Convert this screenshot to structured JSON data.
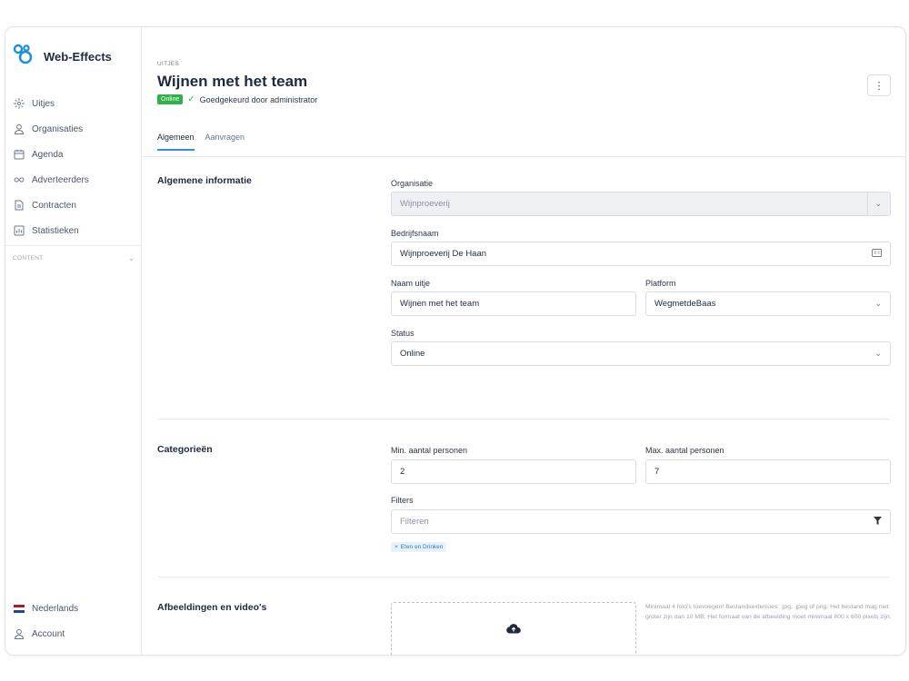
{
  "brand": {
    "name": "Web-Effects"
  },
  "sidebar": {
    "items": [
      {
        "icon": "compass-icon",
        "label": "Uitjes"
      },
      {
        "icon": "user-icon",
        "label": "Organisaties"
      },
      {
        "icon": "calendar-icon",
        "label": "Agenda"
      },
      {
        "icon": "glasses-icon",
        "label": "Adverteerders"
      },
      {
        "icon": "document-icon",
        "label": "Contracten"
      },
      {
        "icon": "chart-icon",
        "label": "Statistieken"
      }
    ],
    "section_label": "CONTENT",
    "bottom": [
      {
        "icon": "flag-nl-icon",
        "label": "Nederlands"
      },
      {
        "icon": "user-icon",
        "label": "Account"
      }
    ]
  },
  "header": {
    "breadcrumb": "UITJES",
    "title": "Wijnen met het team",
    "status_badge": "Online",
    "approval": "Goedgekeurd door administrator",
    "tabs": [
      {
        "label": "Algemeen",
        "active": true
      },
      {
        "label": "Aanvragen",
        "active": false
      }
    ]
  },
  "general": {
    "title": "Algemene informatie",
    "organisatie_label": "Organisatie",
    "organisatie_value": "Wijnproeverij",
    "bedrijfsnaam_label": "Bedrijfsnaam",
    "bedrijfsnaam_value": "Wijnproeverij De Haan",
    "naam_label": "Naam uitje",
    "naam_value": "Wijnen met het team",
    "platform_label": "Platform",
    "platform_value": "WegmetdeBaas",
    "status_label": "Status",
    "status_value": "Online"
  },
  "categories": {
    "title": "Categorieën",
    "min_label": "Min. aantal personen",
    "min_value": "2",
    "max_label": "Max. aantal personen",
    "max_value": "7",
    "filters_label": "Filters",
    "filters_placeholder": "Filteren",
    "tag": "Eten en Drinken"
  },
  "media": {
    "title": "Afbeeldingen en video's",
    "hint": "Minimaal 4 foto's toevoegen! Bestandsextensies: .jpg, .jpeg of png. Het bestand mag niet groter zijn dan 10 MB. Het formaat van de afbeelding moet minimaal 800 x 600 pixels zijn."
  },
  "colors": {
    "accent": "#2f8fe0",
    "online_green": "#2fb14a",
    "brand_blue": "#1e8fd9"
  }
}
